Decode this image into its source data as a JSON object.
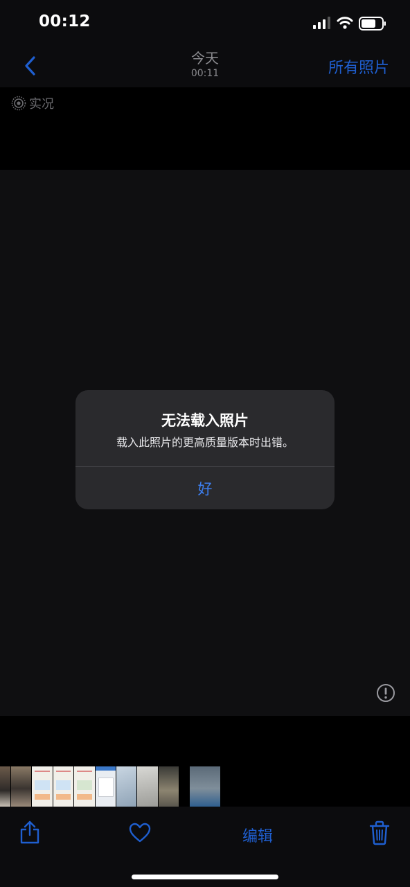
{
  "status": {
    "time": "00:12"
  },
  "nav": {
    "title": "今天",
    "subtitle": "00:11",
    "all_photos": "所有照片"
  },
  "live": {
    "label": "实况"
  },
  "alert": {
    "title": "无法载入照片",
    "message": "载入此照片的更高质量版本时出错。",
    "ok": "好"
  },
  "toolbar": {
    "edit": "编辑"
  },
  "icons": {
    "back": "chevron-left-icon",
    "live": "live-photo-icon",
    "warning": "exclamation-circle-icon",
    "share": "share-icon",
    "favorite": "heart-icon",
    "delete": "trash-icon"
  },
  "colors": {
    "accent": "#1f5fd0",
    "alert_button": "#3d7ff0",
    "background": "#000000"
  }
}
